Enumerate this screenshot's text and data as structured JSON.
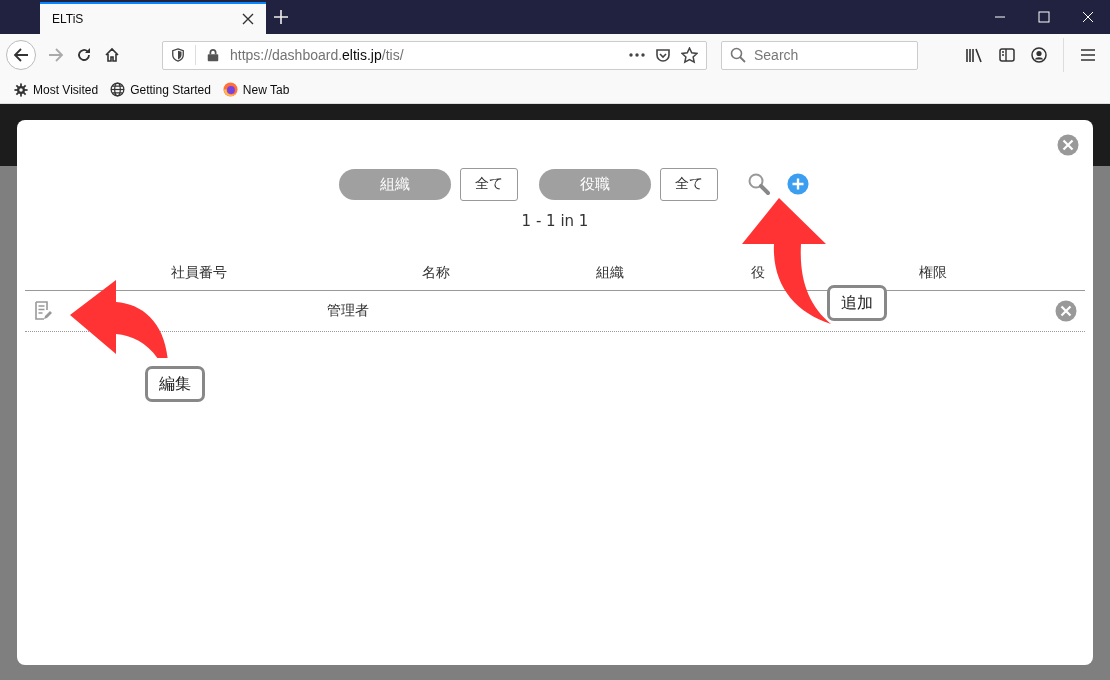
{
  "browser": {
    "tab": {
      "title": "ELTiS"
    },
    "url": {
      "prefix": "https://dashboard.",
      "domain": "eltis.jp",
      "path": "/tis/"
    },
    "search": {
      "placeholder": "Search"
    },
    "bookmarks": [
      {
        "label": "Most Visited"
      },
      {
        "label": "Getting Started"
      },
      {
        "label": "New Tab"
      }
    ]
  },
  "dialog": {
    "filters": [
      {
        "kind": "pill",
        "label": "組織"
      },
      {
        "kind": "box",
        "label": "全て"
      },
      {
        "kind": "pill",
        "label": "役職"
      },
      {
        "kind": "box",
        "label": "全て"
      }
    ],
    "pagination": "1 - 1 in 1",
    "table": {
      "columns": [
        "社員番号",
        "名称",
        "組織",
        "役",
        "権限"
      ],
      "rows": [
        {
          "name": "管理者"
        }
      ]
    }
  },
  "callouts": [
    {
      "label": "追加"
    },
    {
      "label": "編集"
    }
  ]
}
